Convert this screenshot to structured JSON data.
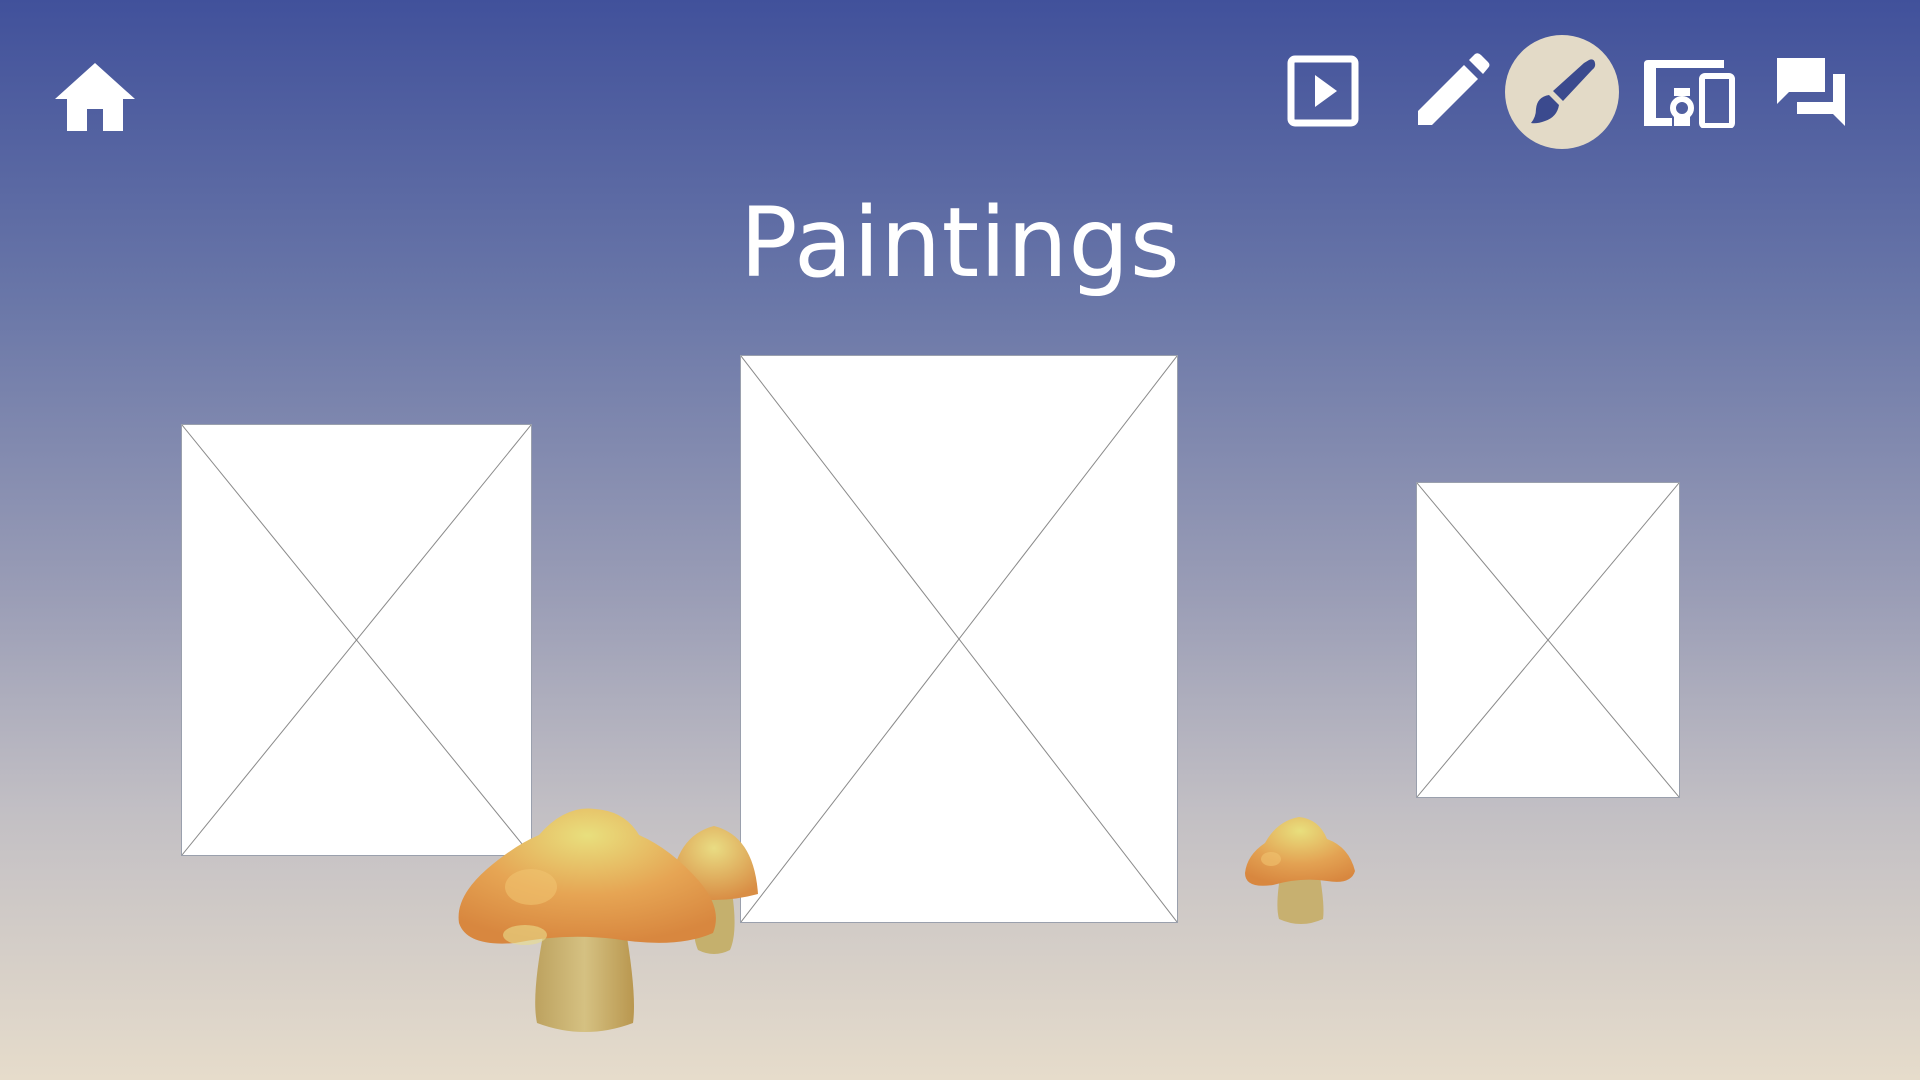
{
  "nav": {
    "home": {
      "icon": "home-icon"
    },
    "actions": [
      {
        "name": "present",
        "icon": "play-box-icon"
      },
      {
        "name": "edit",
        "icon": "pencil-icon"
      },
      {
        "name": "paint",
        "icon": "paintbrush-icon",
        "active": true
      },
      {
        "name": "devices",
        "icon": "devices-icon"
      },
      {
        "name": "chat",
        "icon": "chat-icon"
      }
    ]
  },
  "page": {
    "title": "Paintings"
  },
  "paintings": [
    {
      "label": "painting-placeholder-1"
    },
    {
      "label": "painting-placeholder-2"
    },
    {
      "label": "painting-placeholder-3"
    }
  ],
  "colors": {
    "gradient_top": "#41519b",
    "gradient_bottom": "#e6dccb",
    "active_circle": "#e3dac7",
    "active_icon": "#3b4a8e",
    "icon": "#ffffff"
  }
}
